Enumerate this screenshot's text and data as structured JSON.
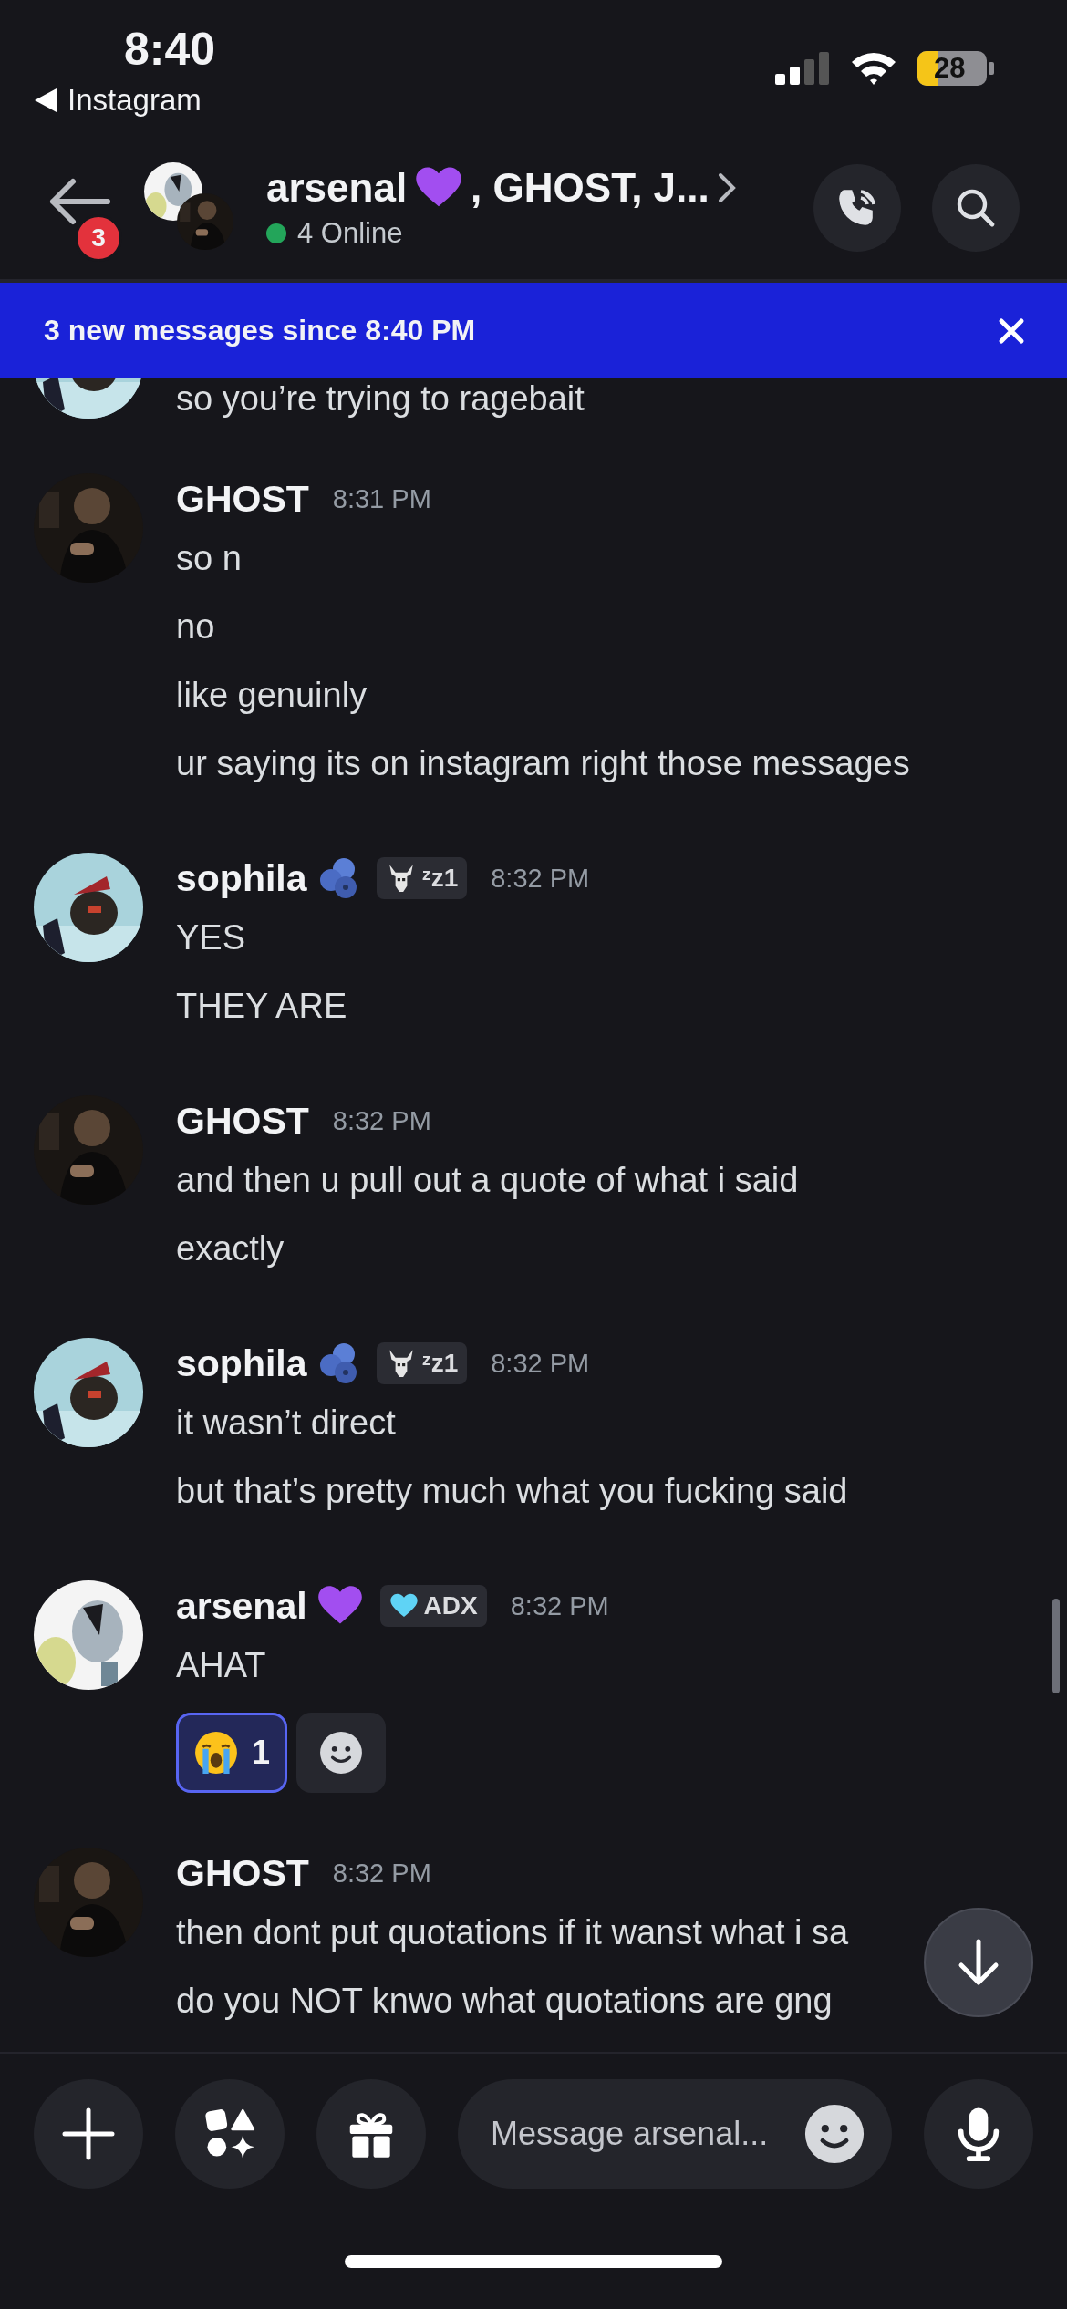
{
  "status_bar": {
    "time": "8:40",
    "back_label": "Instagram",
    "battery": "28"
  },
  "header": {
    "unread_badge": "3",
    "title_name": "arsenal",
    "title_rest": ", GHOST, J...",
    "online": "4 Online"
  },
  "banner": {
    "text": "3 new messages since 8:40 PM"
  },
  "messages": [
    {
      "kind": "continuation",
      "lines": [
        "so you’re trying to ragebait"
      ]
    },
    {
      "kind": "plain",
      "author": "GHOST",
      "time": "8:31 PM",
      "lines": [
        "so n",
        "no",
        "like genuinly",
        "ur saying its on instagram right those messages"
      ]
    },
    {
      "kind": "fruit",
      "author": "sophila",
      "badge": {
        "text": "ᶻz1"
      },
      "time": "8:32 PM",
      "lines": [
        "YES",
        "THEY ARE"
      ]
    },
    {
      "kind": "plain",
      "author": "GHOST",
      "time": "8:32 PM",
      "lines": [
        "and then u pull out a quote of what i said",
        "exactly"
      ]
    },
    {
      "kind": "fruit",
      "author": "sophila",
      "badge": {
        "text": "ᶻz1"
      },
      "time": "8:32 PM",
      "lines": [
        "it wasn’t direct",
        "but that’s pretty much what you fucking said"
      ]
    },
    {
      "kind": "heart",
      "author": "arsenal",
      "badge": {
        "text": "ADX"
      },
      "time": "8:32 PM",
      "lines": [
        "AHAT"
      ],
      "reactions": [
        {
          "count": "1",
          "selected": true
        }
      ]
    },
    {
      "kind": "plain",
      "author": "GHOST",
      "time": "8:32 PM",
      "lines": [
        "then dont put quotations if it wanst what i sa",
        "do you NOT knwo what quotations are gng"
      ]
    }
  ],
  "composer": {
    "placeholder": "Message arsenal..."
  }
}
